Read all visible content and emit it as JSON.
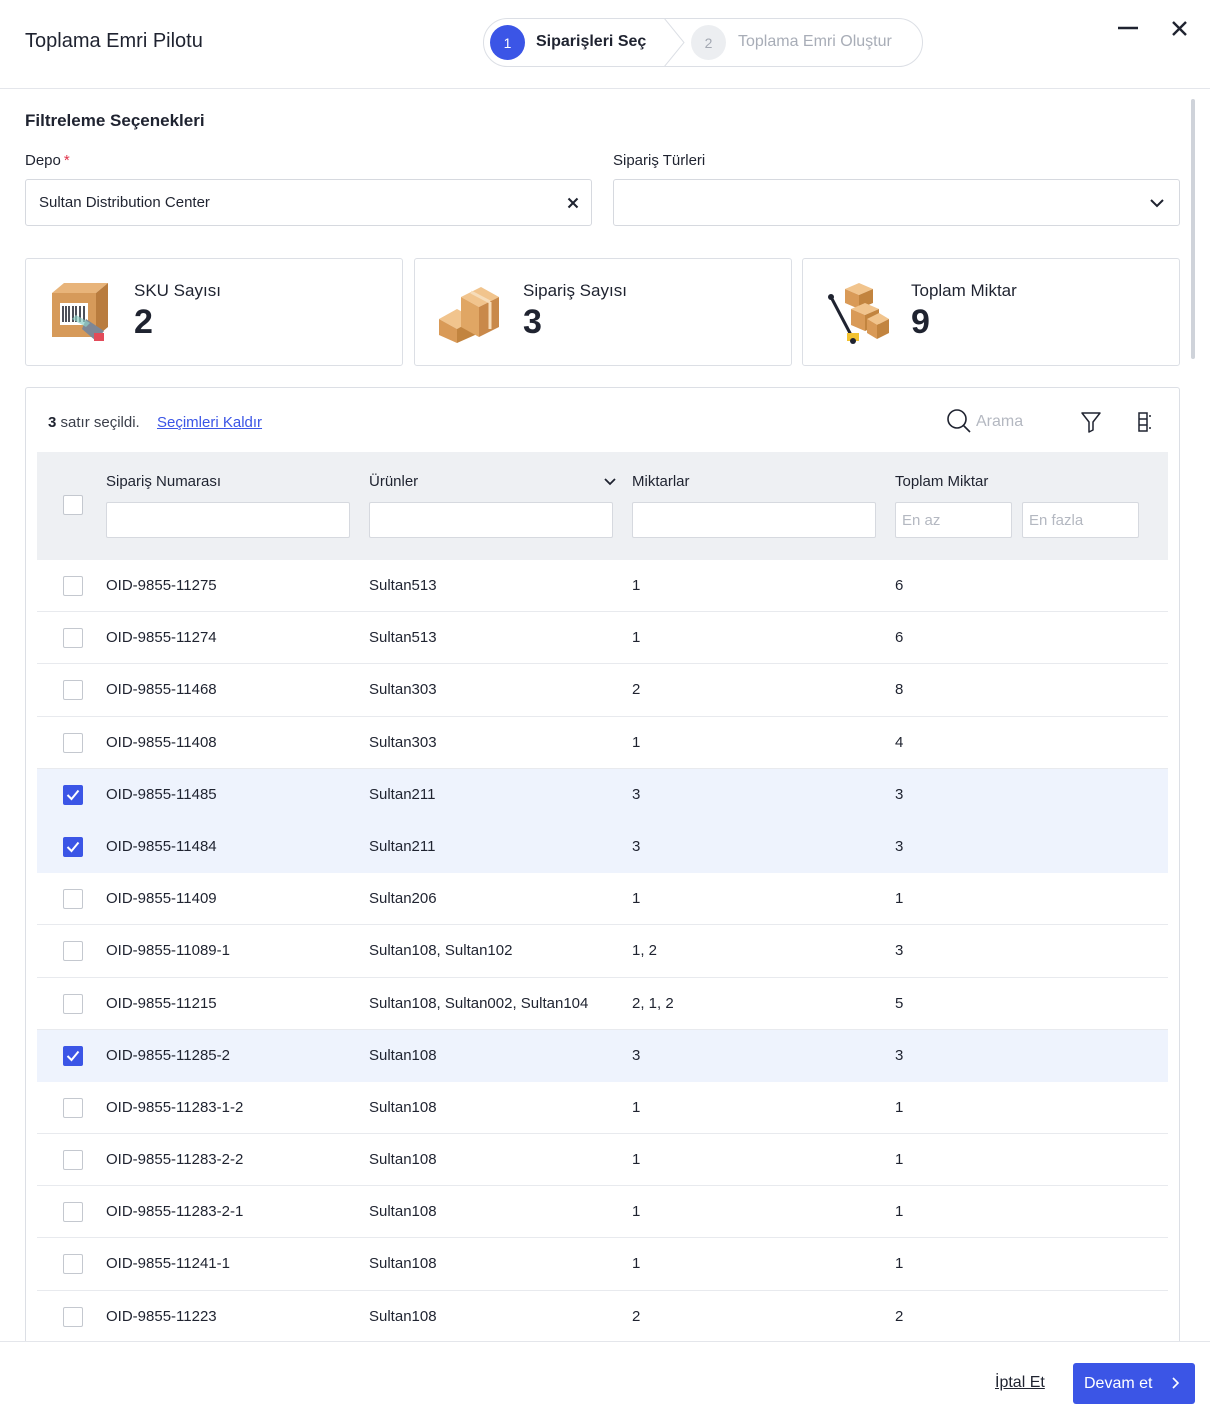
{
  "header": {
    "title": "Toplama Emri Pilotu",
    "steps": [
      {
        "number": "1",
        "label": "Siparişleri Seç",
        "active": true
      },
      {
        "number": "2",
        "label": "Toplama Emri Oluştur",
        "active": false
      }
    ]
  },
  "filters": {
    "title": "Filtreleme Seçenekleri",
    "depot_label": "Depo",
    "depot_required": "*",
    "depot_value": "Sultan Distribution Center",
    "order_types_label": "Sipariş Türleri",
    "order_types_value": ""
  },
  "stats": [
    {
      "label": "SKU Sayısı",
      "value": "2",
      "icon": "barcode-box-icon"
    },
    {
      "label": "Sipariş Sayısı",
      "value": "3",
      "icon": "stacked-boxes-icon"
    },
    {
      "label": "Toplam Miktar",
      "value": "9",
      "icon": "pallet-jack-boxes-icon"
    }
  ],
  "table": {
    "selected_count": "3",
    "selected_suffix": "satır seçildi.",
    "clear_selection": "Seçimleri Kaldır",
    "search_placeholder": "Arama",
    "columns": {
      "order_no": "Sipariş Numarası",
      "products": "Ürünler",
      "quantities": "Miktarlar",
      "total": "Toplam Miktar"
    },
    "total_min_placeholder": "En az",
    "total_max_placeholder": "En fazla",
    "rows": [
      {
        "order": "OID-9855-11275",
        "products": "Sultan513",
        "quantities": "1",
        "total": "6",
        "selected": false
      },
      {
        "order": "OID-9855-11274",
        "products": "Sultan513",
        "quantities": "1",
        "total": "6",
        "selected": false
      },
      {
        "order": "OID-9855-11468",
        "products": "Sultan303",
        "quantities": "2",
        "total": "8",
        "selected": false
      },
      {
        "order": "OID-9855-11408",
        "products": "Sultan303",
        "quantities": "1",
        "total": "4",
        "selected": false
      },
      {
        "order": "OID-9855-11485",
        "products": "Sultan211",
        "quantities": "3",
        "total": "3",
        "selected": true
      },
      {
        "order": "OID-9855-11484",
        "products": "Sultan211",
        "quantities": "3",
        "total": "3",
        "selected": true
      },
      {
        "order": "OID-9855-11409",
        "products": "Sultan206",
        "quantities": "1",
        "total": "1",
        "selected": false
      },
      {
        "order": "OID-9855-11089-1",
        "products": "Sultan108, Sultan102",
        "quantities": "1, 2",
        "total": "3",
        "selected": false
      },
      {
        "order": "OID-9855-11215",
        "products": "Sultan108, Sultan002, Sultan104",
        "quantities": "2, 1, 2",
        "total": "5",
        "selected": false
      },
      {
        "order": "OID-9855-11285-2",
        "products": "Sultan108",
        "quantities": "3",
        "total": "3",
        "selected": true
      },
      {
        "order": "OID-9855-11283-1-2",
        "products": "Sultan108",
        "quantities": "1",
        "total": "1",
        "selected": false
      },
      {
        "order": "OID-9855-11283-2-2",
        "products": "Sultan108",
        "quantities": "1",
        "total": "1",
        "selected": false
      },
      {
        "order": "OID-9855-11283-2-1",
        "products": "Sultan108",
        "quantities": "1",
        "total": "1",
        "selected": false
      },
      {
        "order": "OID-9855-11241-1",
        "products": "Sultan108",
        "quantities": "1",
        "total": "1",
        "selected": false
      },
      {
        "order": "OID-9855-11223",
        "products": "Sultan108",
        "quantities": "2",
        "total": "2",
        "selected": false
      }
    ]
  },
  "footer": {
    "cancel": "İptal Et",
    "continue": "Devam et"
  },
  "colors": {
    "accent": "#3b55e6",
    "selected_row": "#eef3fd",
    "header_bg": "#eef0f3",
    "required": "#e0324a"
  }
}
